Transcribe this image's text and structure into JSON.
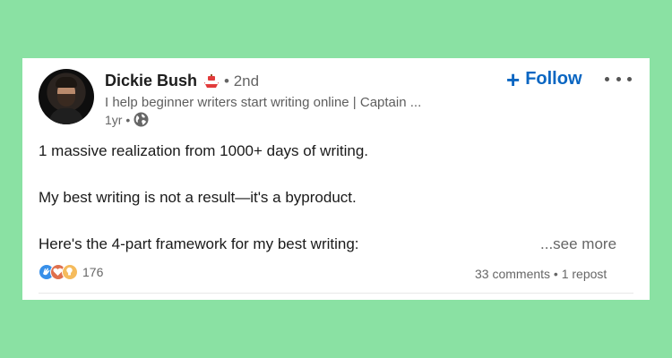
{
  "author": {
    "name": "Dickie Bush",
    "name_emoji": "ship-emoji",
    "degree": "• 2nd",
    "headline": "I help beginner writers start writing online | Captain ...",
    "time": "1yr •"
  },
  "actions": {
    "follow_label": "Follow",
    "more_icon": "more-dots-icon"
  },
  "post": {
    "lines": [
      "1 massive realization from 1000+ days of writing.",
      "My best writing is not a result—it's a byproduct.",
      "Here's the 4-part framework for my best writing:"
    ],
    "see_more": "...see more"
  },
  "social": {
    "reaction_icons": [
      "clap-icon",
      "heart-icon",
      "lightbulb-icon"
    ],
    "reaction_count": "176",
    "stats": "33 comments • 1 repost"
  },
  "colors": {
    "background": "#8ae1a3",
    "link_blue": "#0a66c2",
    "celebrate_blue": "#378fe9",
    "love_red": "#df704d",
    "insight_yellow": "#f5bb5c"
  }
}
